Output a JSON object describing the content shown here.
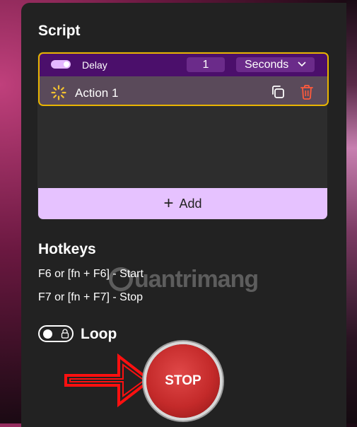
{
  "script": {
    "title": "Script",
    "delay": {
      "enabled": true,
      "label": "Delay",
      "value": "1",
      "unit": "Seconds"
    },
    "action": {
      "label": "Action 1",
      "icon": "spinner-icon"
    },
    "add_label": "Add"
  },
  "hotkeys": {
    "title": "Hotkeys",
    "start": "F6 or [fn + F6] - Start",
    "stop": "F7 or [fn + F7] - Stop"
  },
  "loop": {
    "label": "Loop",
    "enabled": false
  },
  "stop_button": {
    "label": "STOP"
  },
  "watermark": {
    "text": "uantrimang"
  },
  "colors": {
    "accent": "#e6c2ff",
    "highlight_border": "#e8b500",
    "delay_row": "#4b0f6b",
    "stop_red": "#c42a2a",
    "trash_icon": "#ff5a3c"
  }
}
